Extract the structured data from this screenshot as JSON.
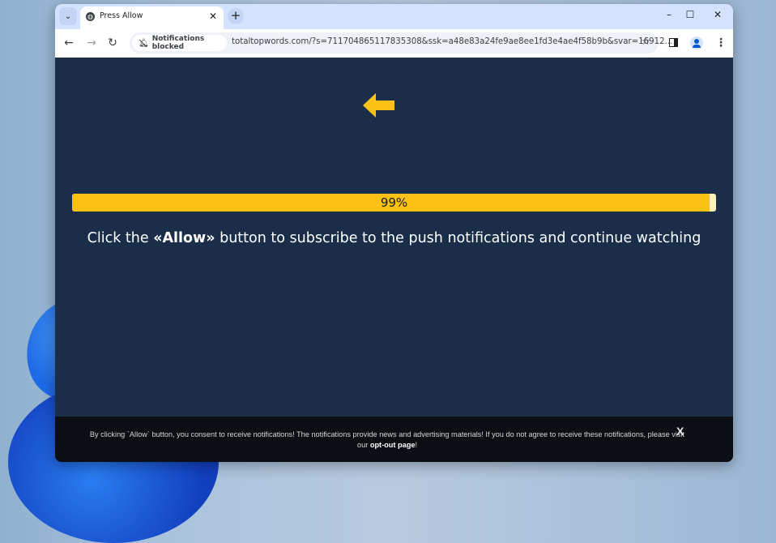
{
  "browser": {
    "tab": {
      "title": "Press Allow",
      "favicon": "globe-icon"
    },
    "tab_list_icon": "chevron-down-icon",
    "new_tab_icon": "plus-icon",
    "window_controls": {
      "minimize": "–",
      "maximize": "☐",
      "close": "✕"
    },
    "nav": {
      "back": "←",
      "forward": "→",
      "reload": "↻"
    },
    "permission_chip": {
      "icon": "bell-off-icon",
      "label": "Notifications blocked"
    },
    "url": "totaltopwords.com/?s=711704865117835308&ssk=a48e83a24fe9ae8ee1fd3e4ae4f58b9b&svar=16912...",
    "bookmark_icon": "☆",
    "menu_icon": "⋮"
  },
  "page": {
    "arrow_icon": "arrow-left-icon",
    "progress": {
      "percent": 99,
      "label": "99%"
    },
    "headline": {
      "before": "Click the ",
      "emphasis": "«Allow»",
      "after": " button to subscribe to the push notifications and continue watching"
    },
    "consent": {
      "text": "By clicking `Allow` button, you consent to receive notifications! The notifications provide news and advertising materials! If you do not agree to receive these notifications, please visit our ",
      "link": "opt-out page",
      "suffix": "!",
      "close": "X"
    }
  },
  "colors": {
    "accent": "#fbc215",
    "page_bg": "#1a2e4a",
    "consent_bg": "#0b0e13",
    "tabbar_bg": "#d3e3fd"
  }
}
